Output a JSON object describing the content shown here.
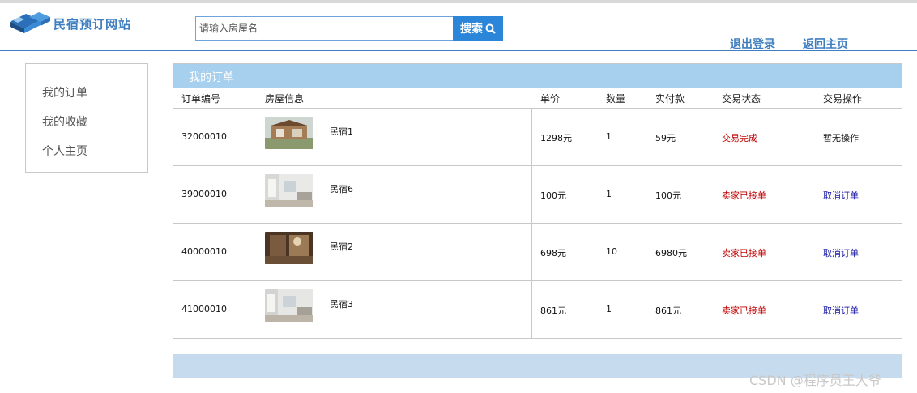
{
  "header": {
    "logo_text": "民宿预订网站",
    "search_placeholder": "请输入房屋名",
    "search_button": "搜索",
    "nav": [
      "退出登录",
      "返回主页"
    ]
  },
  "sidebar": {
    "items": [
      "我的订单",
      "我的收藏",
      "个人主页"
    ]
  },
  "orders": {
    "title": "我的订单",
    "columns": [
      "订单编号",
      "房屋信息",
      "单价",
      "数量",
      "实付款",
      "交易状态",
      "交易操作"
    ],
    "rows": [
      {
        "id": "32000010",
        "house": "民宿1",
        "price": "1298元",
        "qty": "1",
        "paid": "59元",
        "status": "交易完成",
        "action": "暂无操作"
      },
      {
        "id": "39000010",
        "house": "民宿6",
        "price": "100元",
        "qty": "1",
        "paid": "100元",
        "status": "卖家已接单",
        "action": "取消订单"
      },
      {
        "id": "40000010",
        "house": "民宿2",
        "price": "698元",
        "qty": "10",
        "paid": "6980元",
        "status": "卖家已接单",
        "action": "取消订单"
      },
      {
        "id": "41000010",
        "house": "民宿3",
        "price": "861元",
        "qty": "1",
        "paid": "861元",
        "status": "卖家已接单",
        "action": "取消订单"
      }
    ]
  },
  "watermark": "CSDN @程序员王大爷",
  "colors": {
    "accent": "#3f7fc0",
    "header_bar": "#a7cfee",
    "status_red": "#c00000",
    "link_blue": "#1a1aa6"
  }
}
